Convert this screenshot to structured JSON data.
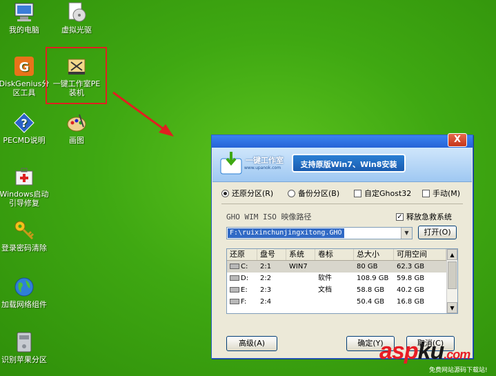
{
  "desktop": {
    "icons": [
      {
        "name": "my-computer",
        "label": "我的电脑"
      },
      {
        "name": "virtual-drive",
        "label": "虚拟光驱"
      },
      {
        "name": "diskgenius",
        "label": "DiskGenius分区工具"
      },
      {
        "name": "onekey-pe-install",
        "label": "一键工作室PE装机"
      },
      {
        "name": "pecmd-help",
        "label": "PECMD说明"
      },
      {
        "name": "paint",
        "label": "画图"
      },
      {
        "name": "windows-boot-repair",
        "label": "Windows启动引导修复"
      },
      {
        "name": "password-clear",
        "label": "登录密码清除"
      },
      {
        "name": "network-load",
        "label": "加载网络组件"
      },
      {
        "name": "apple-partition",
        "label": "识别苹果分区"
      }
    ]
  },
  "dialog": {
    "close": "X",
    "logo_title": "一键工作室",
    "logo_url": "www.upanok.com",
    "slogan": "支持原版Win7、Win8安装",
    "options": {
      "restore": "还原分区(R)",
      "backup": "备份分区(B)",
      "custom_ghost": "自定Ghost32",
      "manual": "手动(M)"
    },
    "path_label": "GHO WIM ISO 映像路径",
    "rescue_label": "释放急救系统",
    "path_value": "F:\\ruixinchunjingxitong.GHO",
    "open_button": "打开(O)",
    "table": {
      "headers": [
        "还原",
        "盘号",
        "系统",
        "卷标",
        "总大小",
        "可用空间"
      ],
      "rows": [
        [
          "C:",
          "2:1",
          "WIN7",
          "",
          "80 GB",
          "62.3 GB"
        ],
        [
          "D:",
          "2:2",
          "",
          "软件",
          "108.9 GB",
          "59.8 GB"
        ],
        [
          "E:",
          "2:3",
          "",
          "文档",
          "58.8 GB",
          "40.2 GB"
        ],
        [
          "F:",
          "2:4",
          "",
          "",
          "50.4 GB",
          "16.8 GB"
        ]
      ]
    },
    "advanced_button": "高级(A)",
    "ok_button": "确定(Y)",
    "cancel_button": "取消(C)"
  },
  "watermark": {
    "brand_a": "asp",
    "brand_b": "ku",
    "brand_c": ".com",
    "sub": "免费网站源码下载站!"
  },
  "colors": {
    "desktop": "#3fa812",
    "highlight": "#e02020",
    "title": "#2663d6"
  }
}
